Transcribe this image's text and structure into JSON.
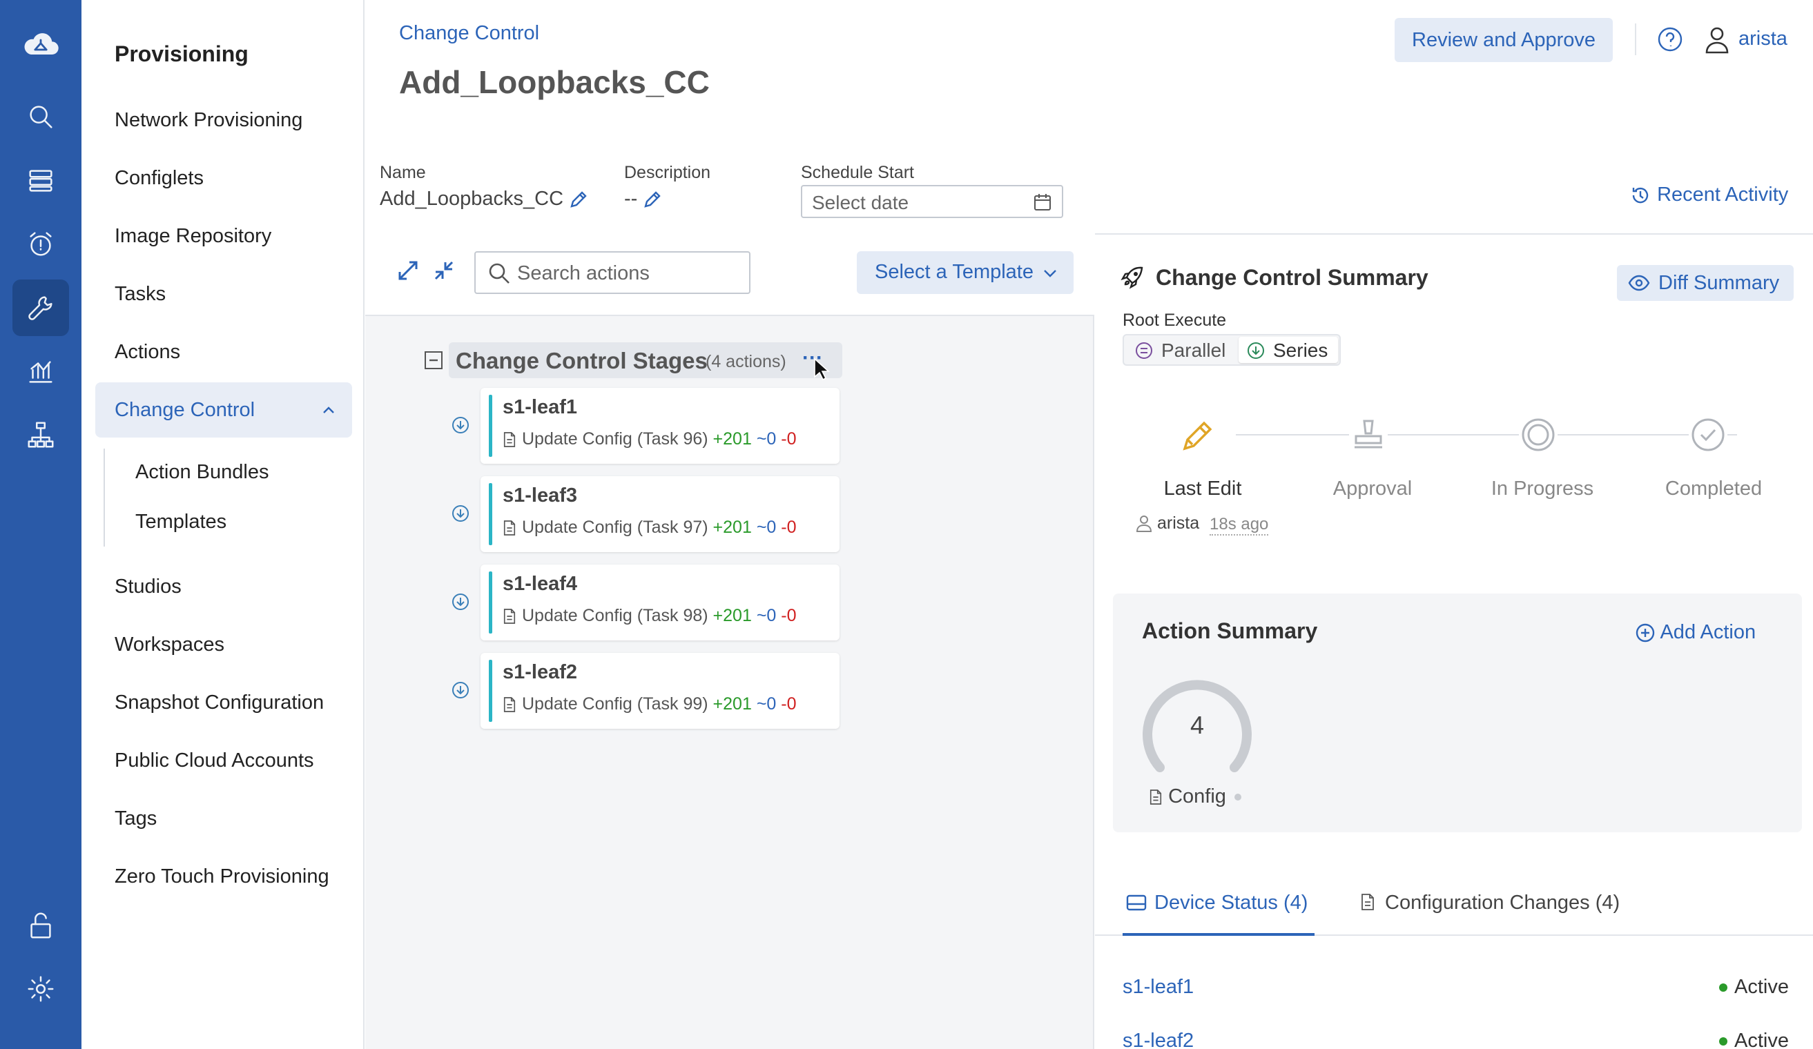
{
  "nav": {
    "title": "Provisioning",
    "items": [
      "Network Provisioning",
      "Configlets",
      "Image Repository",
      "Tasks",
      "Actions",
      "Change Control",
      "Studios",
      "Workspaces",
      "Snapshot Configuration",
      "Public Cloud Accounts",
      "Tags",
      "Zero Touch Provisioning"
    ],
    "sub_items": [
      "Action Bundles",
      "Templates"
    ]
  },
  "header": {
    "breadcrumb": "Change Control",
    "title": "Add_Loopbacks_CC",
    "review_button": "Review and Approve",
    "user": "arista",
    "recent_activity": "Recent Activity"
  },
  "fields": {
    "name_label": "Name",
    "name_value": "Add_Loopbacks_CC",
    "description_label": "Description",
    "description_value": "--",
    "schedule_label": "Schedule Start",
    "schedule_placeholder": "Select date"
  },
  "toolbar": {
    "search_placeholder": "Search actions",
    "template_button": "Select a Template"
  },
  "stages": {
    "title": "Change Control Stages",
    "count": "(4 actions)",
    "more": "···",
    "actions": [
      {
        "device": "s1-leaf1",
        "desc": "Update Config (Task 96)",
        "added": "+201",
        "changed": "~0",
        "removed": "-0"
      },
      {
        "device": "s1-leaf3",
        "desc": "Update Config (Task 97)",
        "added": "+201",
        "changed": "~0",
        "removed": "-0"
      },
      {
        "device": "s1-leaf4",
        "desc": "Update Config (Task 98)",
        "added": "+201",
        "changed": "~0",
        "removed": "-0"
      },
      {
        "device": "s1-leaf2",
        "desc": "Update Config (Task 99)",
        "added": "+201",
        "changed": "~0",
        "removed": "-0"
      }
    ]
  },
  "summary": {
    "title": "Change Control Summary",
    "diff_button": "Diff Summary",
    "root_execute_label": "Root Execute",
    "parallel": "Parallel",
    "series": "Series",
    "steps": [
      "Last Edit",
      "Approval",
      "In Progress",
      "Completed"
    ],
    "last_edit_user": "arista",
    "last_edit_time": "18s ago"
  },
  "action_summary": {
    "title": "Action Summary",
    "add_button": "Add Action",
    "count": "4",
    "type_label": "Config"
  },
  "tabs": {
    "device_status": "Device Status (4)",
    "config_changes": "Configuration Changes (4)"
  },
  "devices": [
    {
      "name": "s1-leaf1",
      "status": "Active"
    },
    {
      "name": "s1-leaf2",
      "status": "Active"
    }
  ],
  "colors": {
    "rail": "#2a5aa8",
    "accent": "#2c64b8",
    "stage_bar": "#2bb5c6",
    "added": "#2a9a2a",
    "removed": "#d02020",
    "active_dot": "#2a9a2a",
    "pencil": "#e0a526"
  }
}
